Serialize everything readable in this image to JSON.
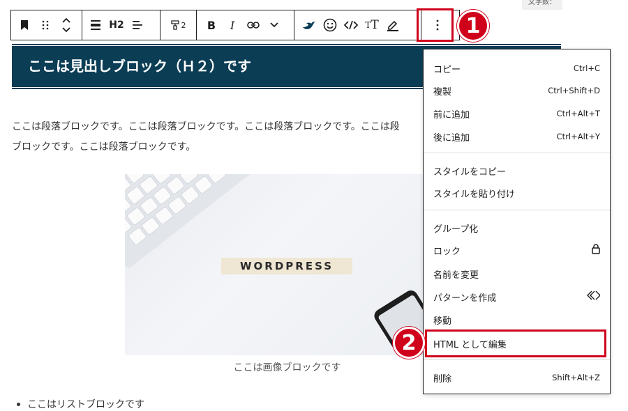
{
  "header": {
    "word_count_label": "文字数："
  },
  "toolbar": {
    "heading_level": "H2",
    "style_count": "2",
    "items": [
      "bookmark-icon",
      "drag-handle-icon",
      "move-updown-icon",
      "align-icon",
      "heading-level",
      "text-align-icon",
      "style-paint-icon",
      "bold-icon",
      "italic-icon",
      "link-icon",
      "chevron-down-icon",
      "bird-icon",
      "emoji-icon",
      "code-icon",
      "text-size-icon",
      "highlighter-icon",
      "options-icon"
    ]
  },
  "content": {
    "heading": "ここは見出しブロック（Ｈ２）です",
    "paragraph_line1": "ここは段落ブロックです。ここは段落ブロックです。ここは段落ブロックです。ここは段",
    "paragraph_line2": "ブロックです。ここは段落ブロックです。",
    "image_word": "WORDPRESS",
    "image_caption": "ここは画像ブロックです",
    "list_item": "ここはリストブロックです"
  },
  "menu": {
    "group1": [
      {
        "label": "コピー",
        "shortcut": "Ctrl+C"
      },
      {
        "label": "複製",
        "shortcut": "Ctrl+Shift+D"
      },
      {
        "label": "前に追加",
        "shortcut": "Ctrl+Alt+T"
      },
      {
        "label": "後に追加",
        "shortcut": "Ctrl+Alt+Y"
      }
    ],
    "group2": [
      {
        "label": "スタイルをコピー"
      },
      {
        "label": "スタイルを貼り付け"
      }
    ],
    "group3": [
      {
        "label": "グループ化"
      },
      {
        "label": "ロック",
        "icon": "lock-icon"
      },
      {
        "label": "名前を変更"
      },
      {
        "label": "パターンを作成",
        "icon": "diamond-icon"
      },
      {
        "label": "移動"
      },
      {
        "label": "HTML として編集"
      }
    ],
    "group4": [
      {
        "label": "削除",
        "shortcut": "Shift+Alt+Z"
      }
    ]
  },
  "annotations": {
    "step1": "1",
    "step2": "2"
  },
  "colors": {
    "heading_bg": "#0b3d55",
    "annotation_red": "#d0021b"
  }
}
